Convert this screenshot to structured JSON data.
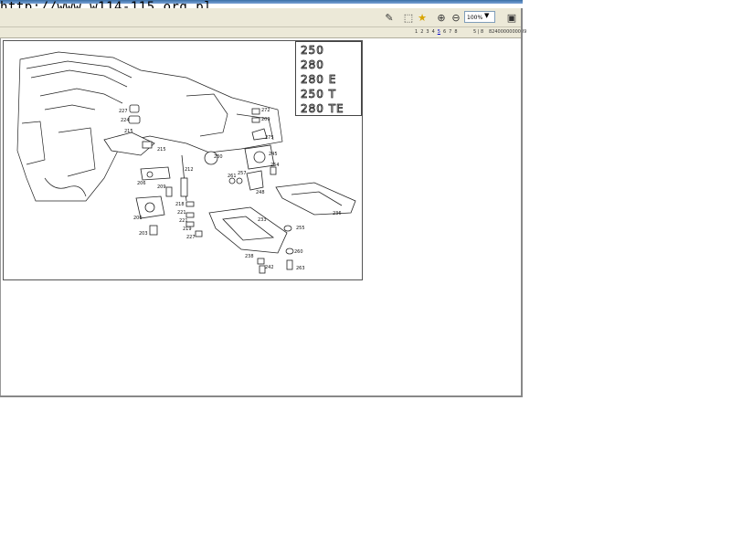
{
  "overlay": {
    "url": "http://www.w114-115.org.pl"
  },
  "toolbar": {
    "zoom_value": "100%"
  },
  "pagination": {
    "pages": [
      "1",
      "2",
      "3",
      "4",
      "5",
      "6",
      "7",
      "8"
    ],
    "active_page": "5",
    "page_count": "5 | 8",
    "part_number": "8240000000089"
  },
  "models": [
    "250",
    "280",
    "280 E",
    "250 T",
    "280 TE"
  ],
  "callouts": [
    "227",
    "224",
    "215",
    "215",
    "212",
    "230",
    "206",
    "209",
    "200",
    "203",
    "218",
    "221",
    "221",
    "219",
    "227",
    "272",
    "209",
    "275",
    "245",
    "254",
    "261",
    "257",
    "248",
    "233",
    "236",
    "255",
    "238",
    "242",
    "260",
    "263"
  ]
}
